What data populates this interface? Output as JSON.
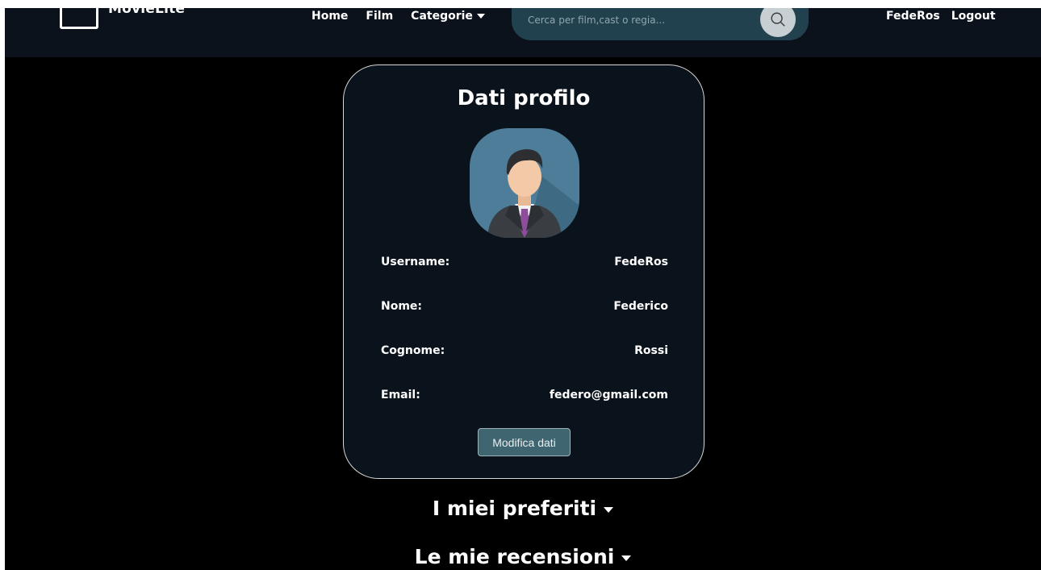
{
  "header": {
    "logo_text": "MovieLite",
    "nav": [
      {
        "label": "Home"
      },
      {
        "label": "Film"
      },
      {
        "label": "Categorie"
      }
    ],
    "search": {
      "placeholder": "Cerca per film,cast o regia...",
      "value": ""
    },
    "username": "FedeRos",
    "logout_label": "Logout"
  },
  "profile": {
    "title": "Dati profilo",
    "fields": [
      {
        "label": "Username:",
        "value": "FedeRos"
      },
      {
        "label": "Nome:",
        "value": "Federico"
      },
      {
        "label": "Cognome:",
        "value": "Rossi"
      },
      {
        "label": "Email:",
        "value": "federo@gmail.com"
      }
    ],
    "edit_label": "Modifica dati"
  },
  "sections": {
    "favorites": "I miei preferiti",
    "reviews": "Le mie recensioni"
  },
  "colors": {
    "navbar": "#0b121c",
    "card": "#0a121c",
    "search": "#22414e",
    "button": "#3f6570"
  }
}
